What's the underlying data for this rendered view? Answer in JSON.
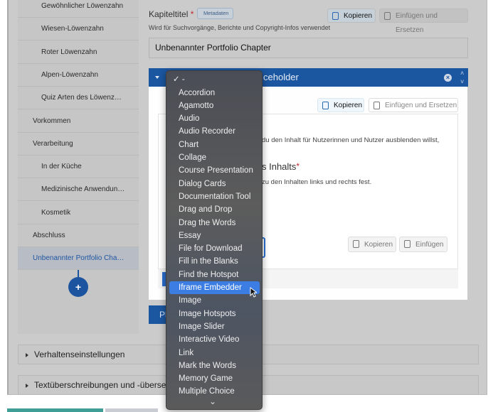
{
  "sidebar": {
    "items": [
      {
        "label": "Gewöhnlicher Löwenzahn",
        "level": "sub"
      },
      {
        "label": "Wiesen-Löwenzahn",
        "level": "sub"
      },
      {
        "label": "Roter Löwenzahn",
        "level": "sub"
      },
      {
        "label": "Alpen-Löwenzahn",
        "level": "sub"
      },
      {
        "label": "Quiz Arten des Löwenz…",
        "level": "sub"
      },
      {
        "label": "Vorkommen",
        "level": "top"
      },
      {
        "label": "Verarbeitung",
        "level": "top"
      },
      {
        "label": "In der Küche",
        "level": "sub"
      },
      {
        "label": "Medizinische Anwendun…",
        "level": "sub"
      },
      {
        "label": "Kosmetik",
        "level": "sub"
      },
      {
        "label": "Abschluss",
        "level": "top"
      },
      {
        "label": "Unbenannter Portfolio Cha…",
        "level": "top",
        "selected": true
      }
    ],
    "add_label": "+"
  },
  "chapter": {
    "title_label": "Kapiteltitel",
    "required": "*",
    "metadata_label": "Metadaten",
    "description": "Wird für Suchvorgänge, Berichte und Copyright-Infos verwendet",
    "value": "Unbenannter Portfolio Chapter",
    "copy_label": "Kopieren",
    "paste_replace_label": "Einfügen und Ersetzen"
  },
  "content": {
    "header_text": "ceholder",
    "copy_label": "Kopieren",
    "paste_replace_label": "Einfügen und Ersetzen",
    "text1": "du den Inhalt für Nutzerinnen und Nutzer ausblenden willst,",
    "heading2": "s Inhalts",
    "required": "*",
    "text2": "zu den Inhalten links und rechts fest.",
    "copy2_label": "Kopieren",
    "paste2_label": "Einfügen",
    "partial_button": "Pl"
  },
  "accordions": [
    "Verhaltenseinstellungen",
    "Textüberschreibungen und -überse"
  ],
  "dropdown": {
    "selected": "✓ -",
    "highlighted": "Iframe Embedder",
    "options": [
      "Accordion",
      "Agamotto",
      "Audio",
      "Audio Recorder",
      "Chart",
      "Collage",
      "Course Presentation",
      "Dialog Cards",
      "Documentation Tool",
      "Drag and Drop",
      "Drag the Words",
      "Essay",
      "File for Download",
      "Fill in the Blanks",
      "Find the Hotspot",
      "Iframe Embedder",
      "Image",
      "Image Hotspots",
      "Image Slider",
      "Interactive Video",
      "Link",
      "Mark the Words",
      "Memory Game",
      "Multiple Choice"
    ],
    "more_icon": "⌄"
  },
  "colors": {
    "primary": "#1b56a0",
    "highlight": "#3b7de2",
    "teal": "#3f9e96"
  }
}
